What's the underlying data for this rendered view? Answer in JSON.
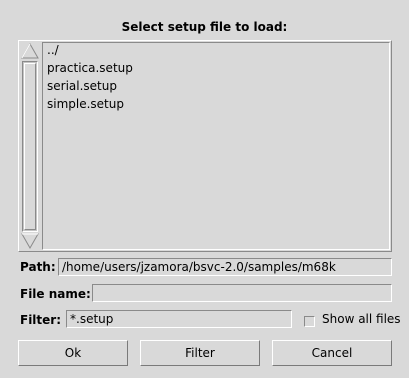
{
  "dialog": {
    "title": "Select setup file to load:"
  },
  "file_list": {
    "items": [
      "../",
      "practica.setup",
      "serial.setup",
      "simple.setup"
    ]
  },
  "path": {
    "label": "Path:",
    "value": "/home/users/jzamora/bsvc-2.0/samples/m68k"
  },
  "file_name": {
    "label": "File name:",
    "value": ""
  },
  "filter": {
    "label": "Filter:",
    "value": "*.setup"
  },
  "show_all": {
    "label": "Show all files",
    "checked": false
  },
  "buttons": {
    "ok": "Ok",
    "filter": "Filter",
    "cancel": "Cancel"
  },
  "icons": {
    "scroll_up": "triangle-up-icon",
    "scroll_down": "triangle-down-icon"
  }
}
